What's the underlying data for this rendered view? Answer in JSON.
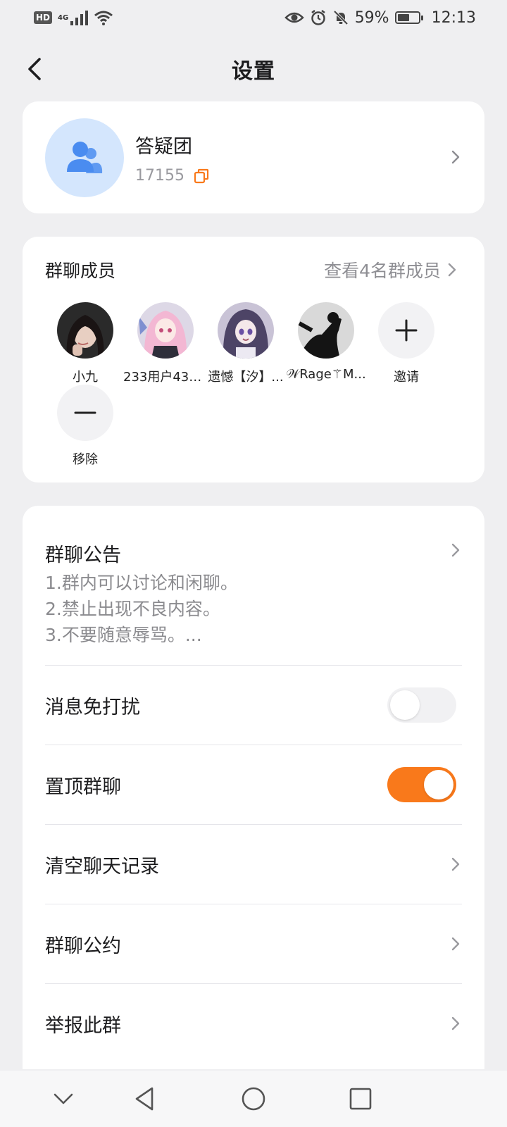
{
  "status_bar": {
    "hd": "HD",
    "network": "4G",
    "battery": "59%",
    "battery_level": 0.59,
    "time": "12:13"
  },
  "header": {
    "title": "设置"
  },
  "group": {
    "name": "答疑团",
    "id": "17155"
  },
  "members": {
    "title": "群聊成员",
    "view_all": "查看4名群成员",
    "list": [
      {
        "name": "小九"
      },
      {
        "name": "233用户438..."
      },
      {
        "name": "遗憾【汐】..."
      },
      {
        "name": "𝒲Rage⚚M..."
      }
    ],
    "invite_label": "邀请",
    "remove_label": "移除"
  },
  "settings": {
    "notice_title": "群聊公告",
    "notice_lines": [
      "1.群内可以讨论和闲聊。",
      "2.禁止出现不良内容。",
      "3.不要随意辱骂。..."
    ],
    "mute_label": "消息免打扰",
    "mute_on": false,
    "pin_label": "置顶群聊",
    "pin_on": true,
    "clear_label": "清空聊天记录",
    "rules_label": "群聊公约",
    "report_label": "举报此群"
  },
  "colors": {
    "accent": "#f9791b",
    "avatar_bg": "#d4e6fd",
    "avatar_icon": "#4a8cf0"
  }
}
